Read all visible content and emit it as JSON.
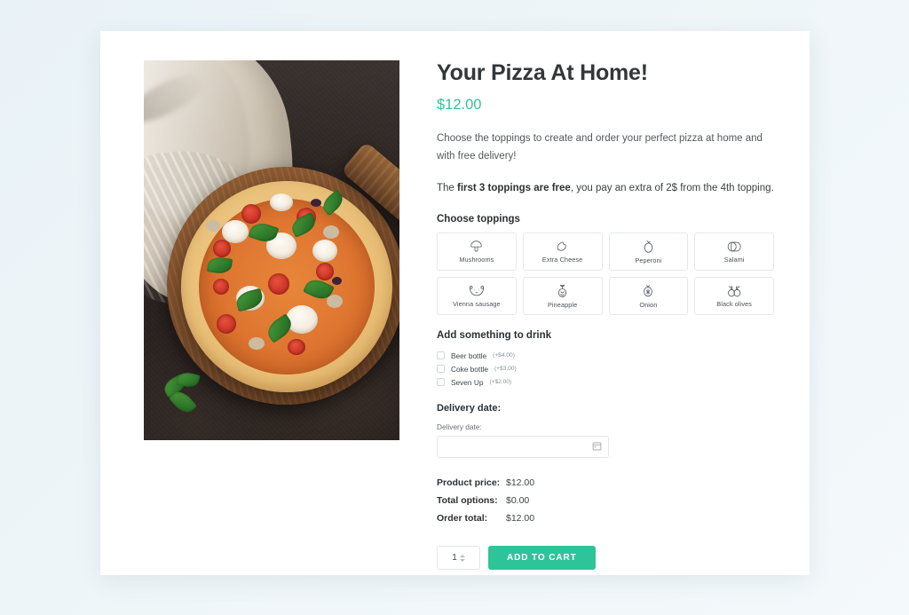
{
  "product": {
    "title": "Your Pizza At Home!",
    "price": "$12.00",
    "description": "Choose the toppings to create and order your perfect pizza at home and with free delivery!",
    "note_prefix": "The ",
    "note_bold": "first 3 toppings are free",
    "note_suffix": ", you pay an extra of 2$ from the 4th topping.",
    "image_alt": "Margherita pizza on wooden board with basil"
  },
  "accent_color": "#2ec49a",
  "toppings": {
    "heading": "Choose toppings",
    "items": [
      {
        "label": "Mushrooms",
        "icon": "mushroom-icon"
      },
      {
        "label": "Extra Cheese",
        "icon": "cheese-icon"
      },
      {
        "label": "Peperoni",
        "icon": "peperoni-icon"
      },
      {
        "label": "Salami",
        "icon": "salami-icon"
      },
      {
        "label": "Vienna sausage",
        "icon": "sausage-icon"
      },
      {
        "label": "Pineapple",
        "icon": "pineapple-icon"
      },
      {
        "label": "Onion",
        "icon": "onion-icon"
      },
      {
        "label": "Black olives",
        "icon": "olives-icon"
      }
    ]
  },
  "drinks": {
    "heading": "Add something to drink",
    "items": [
      {
        "label": "Beer bottle",
        "amount": "(+$4.00)",
        "checked": false
      },
      {
        "label": "Coke bottle",
        "amount": "(+$3.00)",
        "checked": false
      },
      {
        "label": "Seven Up",
        "amount": "(+$2.00)",
        "checked": false
      }
    ]
  },
  "delivery": {
    "heading": "Delivery date:",
    "field_label": "Delivery date:",
    "value": "",
    "placeholder": "",
    "icon": "calendar-icon"
  },
  "totals": {
    "rows": [
      {
        "key": "Product price:",
        "value": "$12.00"
      },
      {
        "key": "Total options:",
        "value": "$0.00"
      },
      {
        "key": "Order total:",
        "value": "$12.00"
      }
    ]
  },
  "cart": {
    "quantity": "1",
    "button_label": "ADD TO CART"
  }
}
